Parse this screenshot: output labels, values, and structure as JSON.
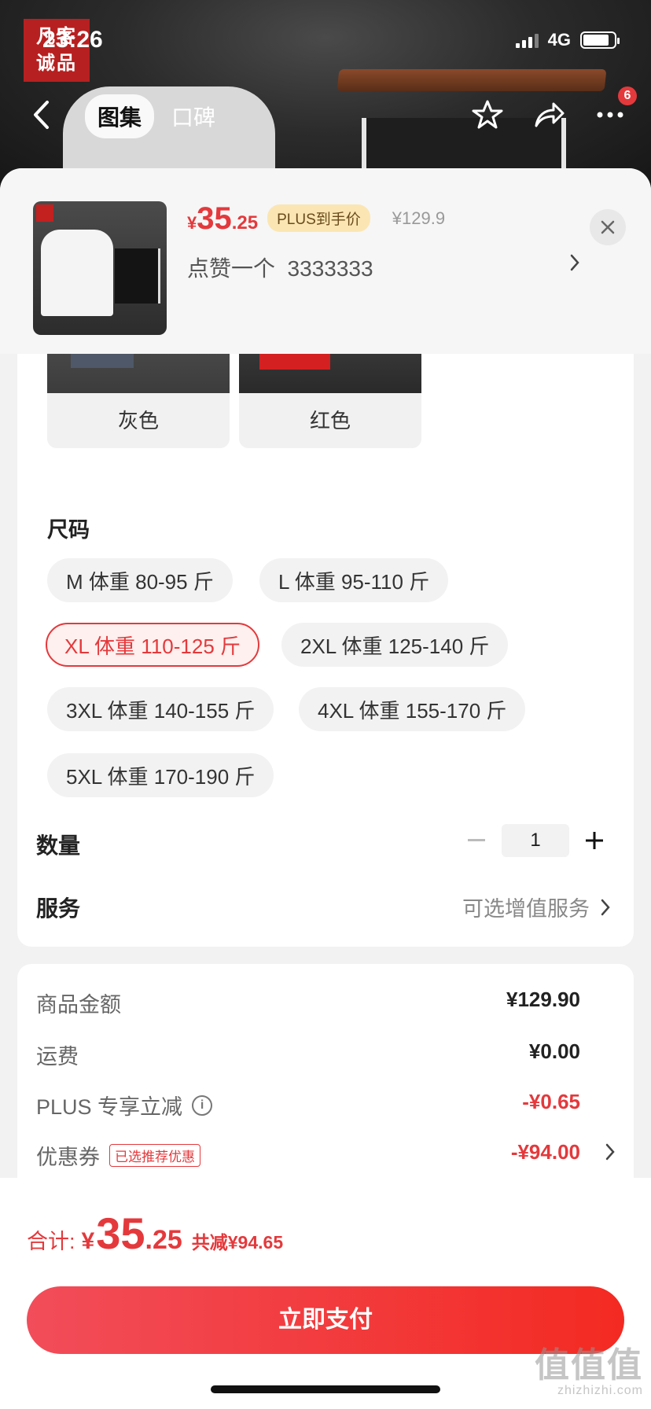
{
  "status_bar": {
    "time": "23:26",
    "network": "4G",
    "battery_level": 0.85
  },
  "brand_logo": "凡客诚品",
  "nav": {
    "tabs": [
      {
        "label": "图集",
        "active": true
      },
      {
        "label": "口碑",
        "active": false
      }
    ],
    "more_badge": "6",
    "icons": [
      "back-icon",
      "star-icon",
      "share-icon",
      "more-icon"
    ]
  },
  "product": {
    "currency": "¥",
    "price_int": "35",
    "price_dec": ".25",
    "plus_tag": "PLUS到手价",
    "original_price": "¥129.9",
    "selected_spec": "点赞一个  3333333"
  },
  "colors": {
    "options": [
      {
        "label": "灰色"
      },
      {
        "label": "红色"
      }
    ]
  },
  "size": {
    "title": "尺码",
    "options": [
      {
        "label": "M 体重 80-95 斤",
        "selected": false
      },
      {
        "label": "L 体重 95-110 斤",
        "selected": false
      },
      {
        "label": "XL 体重 110-125 斤",
        "selected": true
      },
      {
        "label": "2XL 体重 125-140 斤",
        "selected": false
      },
      {
        "label": "3XL 体重 140-155 斤",
        "selected": false
      },
      {
        "label": "4XL 体重 155-170 斤",
        "selected": false
      },
      {
        "label": "5XL 体重 170-190 斤",
        "selected": false
      }
    ]
  },
  "quantity": {
    "label": "数量",
    "value": "1"
  },
  "service": {
    "label": "服务",
    "value": "可选增值服务"
  },
  "fees": {
    "goods_label": "商品金额",
    "goods_value": "¥129.90",
    "shipping_label": "运费",
    "shipping_value": "¥0.00",
    "plus_label": "PLUS 专享立减",
    "plus_value": "-¥0.65",
    "coupon_label": "优惠券",
    "coupon_tag": "已选推荐优惠",
    "coupon_value": "-¥94.00"
  },
  "footer": {
    "total_label": "合计:",
    "total_currency": "¥",
    "total_int": "35",
    "total_dec": ".25",
    "saved": "共减¥94.65",
    "pay_label": "立即支付"
  },
  "watermark": {
    "mark": "值值值",
    "site": "zhizhizhi.com"
  },
  "theme": {
    "accent": "#e4393c",
    "plus_tag_bg": "#fbe6b3"
  }
}
